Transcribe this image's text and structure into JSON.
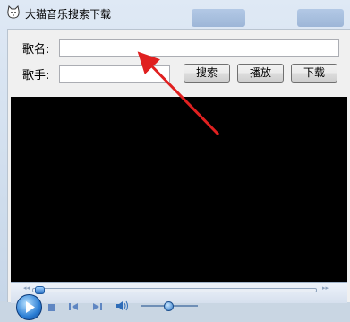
{
  "window": {
    "title": "大猫音乐搜索下载",
    "icon": "cat-icon"
  },
  "form": {
    "song_name_label": "歌名:",
    "song_name_value": "",
    "singer_label": "歌手:",
    "singer_value": ""
  },
  "buttons": {
    "search": "搜索",
    "play": "播放",
    "download": "下载"
  },
  "player": {
    "controls": [
      "play-icon",
      "stop-icon",
      "previous-icon",
      "next-icon",
      "volume-icon"
    ],
    "seek_level": 0.0,
    "volume_level": 0.55
  },
  "annotation": {
    "arrow_color": "#e02020"
  }
}
